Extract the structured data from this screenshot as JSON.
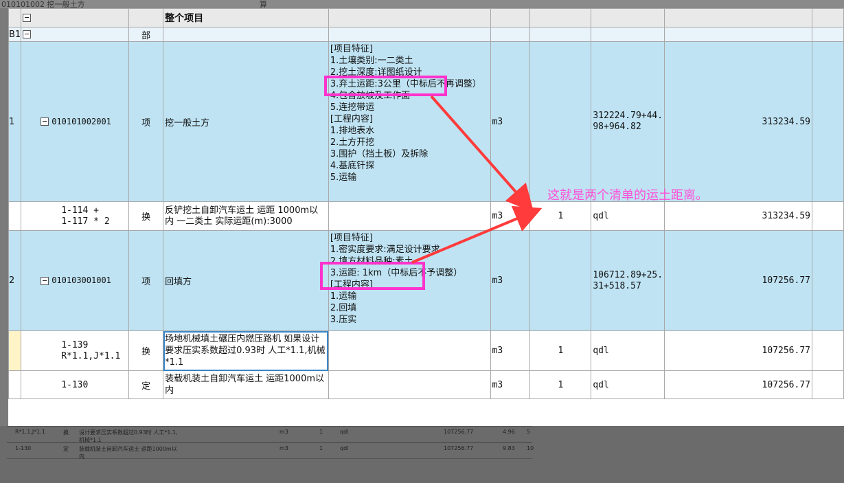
{
  "background": {
    "top_left_text": "010101002 挖一般土方",
    "top_mid_text": "算",
    "rows": [
      {
        "code": "R*1.1,J*1.1",
        "type": "换",
        "name": "设计要求压实系数超过0.93时 人工*1.1,机械*1.1",
        "unit": "m3",
        "qty": "1",
        "expr": "qdl",
        "total": "107256.77",
        "a": "4.96",
        "b": "5"
      },
      {
        "code": "1-130",
        "type": "定",
        "name": "装载机装土自卸汽车运土 运距1000m以内",
        "unit": "m3",
        "qty": "1",
        "expr": "qdl",
        "total": "107256.77",
        "a": "9.83",
        "b": "10"
      }
    ]
  },
  "header": {
    "project": "整个项目"
  },
  "section": {
    "row_num": "B1",
    "type": "部"
  },
  "rows": [
    {
      "row_num": "1",
      "code": "010101002001",
      "type": "项",
      "name": "挖一般土方",
      "features": "[项目特征]\n1.土壤类别:一二类土\n2.挖土深度:详图纸设计\n3.弃土运距:3公里（中标后不再调整）\n4.包含放坡及工作面\n5.连挖带运\n[工程内容]\n1.排地表水\n2.土方开挖\n3.围护（挡土板）及拆除\n4.基底钎探\n5.运输",
      "unit": "m3",
      "qty": "",
      "expr": "312224.79+44.98+964.82",
      "total": "313234.59"
    },
    {
      "code": "1-114 +\n1-117 * 2",
      "type": "换",
      "name": "反铲挖土自卸汽车运土 运距 1000m以内 一二类土  实际运距(m):3000",
      "unit": "m3",
      "qty": "1",
      "expr": "qdl",
      "total": "313234.59"
    },
    {
      "row_num": "2",
      "code": "010103001001",
      "type": "项",
      "name": "回填方",
      "features": "[项目特征]\n1.密实度要求:满足设计要求\n2.填方材料品种:素土\n3.运距: 1km（中标后不予调整）\n[工程内容]\n1.运输\n2.回填\n3.压实",
      "unit": "m3",
      "qty": "",
      "expr": "106712.89+25.31+518.57",
      "total": "107256.77"
    },
    {
      "code": "1-139\nR*1.1,J*1.1",
      "type": "换",
      "name": "场地机械填土碾压内燃压路机 如果设计要求压实系数超过0.93时 人工*1.1,机械*1.1",
      "unit": "m3",
      "qty": "1",
      "expr": "qdl",
      "total": "107256.77"
    },
    {
      "code": "1-130",
      "type": "定",
      "name": "装载机装土自卸汽车运土 运距1000m以内",
      "unit": "m3",
      "qty": "1",
      "expr": "qdl",
      "total": "107256.77"
    }
  ],
  "annotation": {
    "text": "这就是两个清单的运土距离。",
    "highlight_color": "#ff33cc",
    "arrow_color": "#ff3b3b"
  }
}
